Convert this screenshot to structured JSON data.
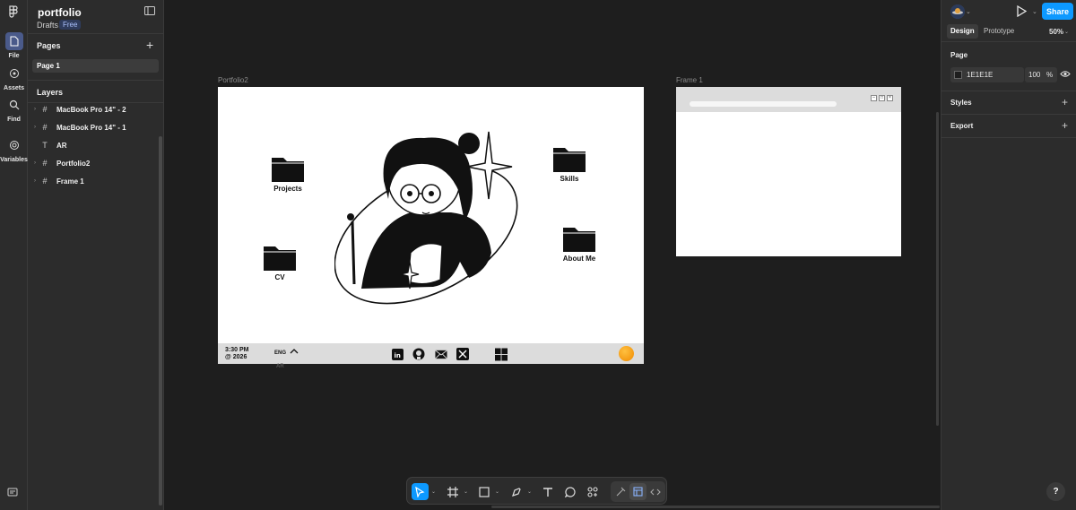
{
  "project": {
    "name": "portfolio",
    "location": "Drafts",
    "plan_badge": "Free"
  },
  "rail": {
    "items": [
      {
        "label": "File",
        "icon": "file-icon"
      },
      {
        "label": "Assets",
        "icon": "assets-icon"
      },
      {
        "label": "Find",
        "icon": "search-icon"
      },
      {
        "label": "Variables",
        "icon": "variables-icon"
      }
    ]
  },
  "pages": {
    "title": "Pages",
    "items": [
      "Page 1"
    ]
  },
  "layers": {
    "title": "Layers",
    "items": [
      {
        "name": "MacBook Pro 14\" - 2",
        "type": "frame"
      },
      {
        "name": "MacBook Pro 14\" - 1",
        "type": "frame"
      },
      {
        "name": "AR",
        "type": "text"
      },
      {
        "name": "Portfolio2",
        "type": "frame"
      },
      {
        "name": "Frame 1",
        "type": "frame"
      }
    ]
  },
  "canvas": {
    "frames": [
      {
        "label": "Portfolio2",
        "folders": [
          "Projects",
          "Skills",
          "CV",
          "About Me"
        ],
        "taskbar": {
          "time": "3:30 PM",
          "year": "@ 2026",
          "lang": "ENG",
          "lang_alt": "AR"
        }
      },
      {
        "label": "Frame 1"
      }
    ]
  },
  "right_panel": {
    "share_label": "Share",
    "tabs": [
      "Design",
      "Prototype"
    ],
    "zoom": "50%",
    "page_section": {
      "title": "Page",
      "color_hex": "1E1E1E",
      "opacity": "100",
      "opacity_unit": "%"
    },
    "styles_title": "Styles",
    "export_title": "Export",
    "help": "?"
  },
  "colors": {
    "accent": "#0d99ff",
    "panel": "#2c2c2c",
    "canvas": "#1e1e1e"
  }
}
